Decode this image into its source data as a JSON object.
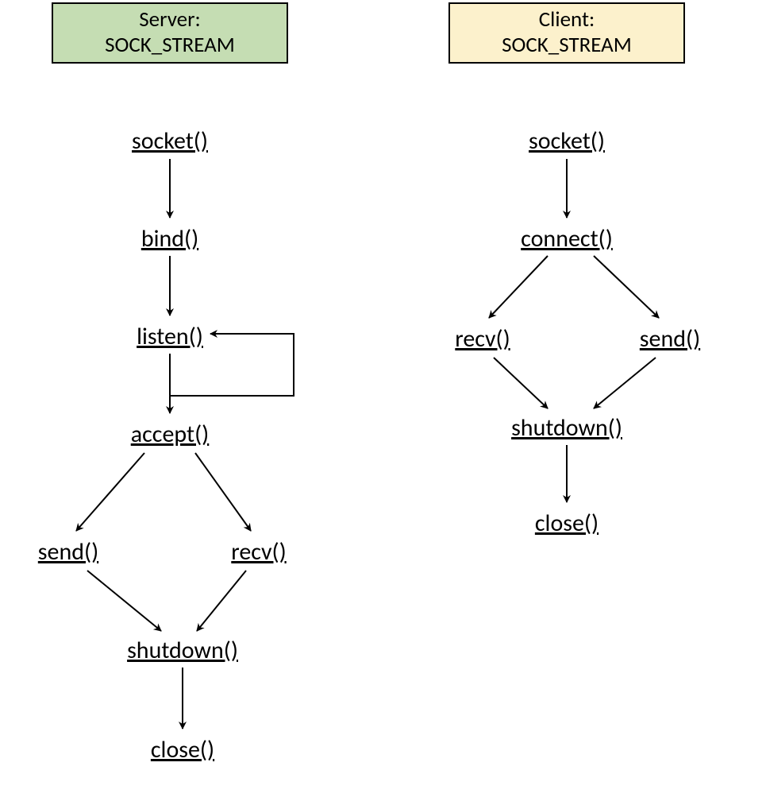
{
  "server": {
    "header_line1": "Server:",
    "header_line2": "SOCK_STREAM",
    "nodes": {
      "socket": "socket()",
      "bind": "bind()",
      "listen": "listen()",
      "accept": "accept()",
      "send": "send()",
      "recv": "recv()",
      "shutdown": "shutdown()",
      "close": "close()"
    }
  },
  "client": {
    "header_line1": "Client:",
    "header_line2": "SOCK_STREAM",
    "nodes": {
      "socket": "socket()",
      "connect": "connect()",
      "recv": "recv()",
      "send": "send()",
      "shutdown": "shutdown()",
      "close": "close()"
    }
  }
}
